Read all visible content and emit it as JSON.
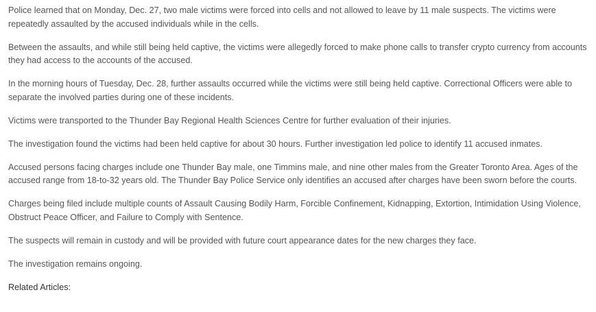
{
  "article": {
    "paragraphs": [
      "Police learned that on Monday, Dec. 27, two male victims were forced into cells and not allowed to leave by 11 male suspects. The victims were repeatedly assaulted by the accused individuals while in the cells.",
      "Between the assaults, and while still being held captive, the victims were allegedly forced to make phone calls to transfer crypto currency from accounts they had access to the accounts of the accused.",
      "In the morning hours of Tuesday, Dec. 28, further assaults occurred while the victims were still being held captive. Correctional Officers were able to separate the involved parties during one of these incidents.",
      "Victims were transported to the Thunder Bay Regional Health Sciences Centre for further evaluation of their injuries.",
      "The investigation found the victims had been held captive for about 30 hours. Further investigation led police to identify 11 accused inmates.",
      "Accused persons facing charges include one Thunder Bay male, one Timmins male, and nine other males from the Greater Toronto Area. Ages of the accused range from 18-to-32 years old. The Thunder Bay Police Service only identifies an accused after charges have been sworn before the courts.",
      "Charges being filed include multiple counts of Assault Causing Bodily Harm, Forcible Confinement, Kidnapping, Extortion, Intimidation Using Violence, Obstruct Peace Officer, and Failure to Comply with Sentence.",
      "The suspects will remain in custody and will be provided with future court appearance dates for the new charges they face.",
      "The investigation remains ongoing."
    ],
    "related_label": "Related Articles:"
  }
}
